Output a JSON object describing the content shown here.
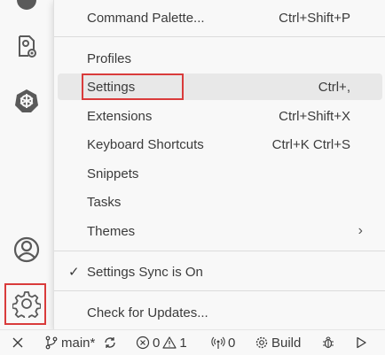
{
  "activity_bar": {
    "icons": [
      "github-icon",
      "extension-settings-icon",
      "kubernetes-icon",
      "accounts-icon",
      "manage-gear-icon"
    ]
  },
  "menu": {
    "items": [
      {
        "label": "Command Palette...",
        "shortcut": "Ctrl+Shift+P"
      },
      {
        "label": "Profiles",
        "shortcut": ""
      },
      {
        "label": "Settings",
        "shortcut": "Ctrl+,"
      },
      {
        "label": "Extensions",
        "shortcut": "Ctrl+Shift+X"
      },
      {
        "label": "Keyboard Shortcuts",
        "shortcut": "Ctrl+K Ctrl+S"
      },
      {
        "label": "Snippets",
        "shortcut": ""
      },
      {
        "label": "Tasks",
        "shortcut": ""
      },
      {
        "label": "Themes",
        "shortcut": "›"
      },
      {
        "label": "Settings Sync is On",
        "check": "✓"
      },
      {
        "label": "Check for Updates..."
      }
    ]
  },
  "status_bar": {
    "branch": "main*",
    "errors": "0",
    "warnings": "1",
    "ports": "0",
    "build_label": "Build"
  },
  "colors": {
    "highlight_border": "#d93b3b",
    "menu_background": "#f8f8f8",
    "active_item_background": "#e8e8e8"
  }
}
